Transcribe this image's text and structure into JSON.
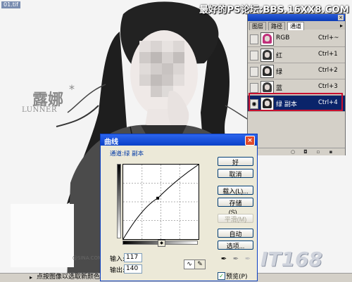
{
  "document": {
    "tab_label": "01.tif"
  },
  "watermarks": {
    "top_right": "最好的PS论坛:BBS.16XX8.COM",
    "bottom_right": "IT168",
    "sina": "@SINA.COM"
  },
  "photo_titles": {
    "chinese": "露娜",
    "english": "LUNNER",
    "star": "*"
  },
  "channels_panel": {
    "tabs": [
      "图层",
      "路径",
      "通道"
    ],
    "active_tab": 2,
    "close_glyph": "×",
    "menu_glyph": "▸",
    "channels": [
      {
        "name": "RGB",
        "shortcut": "Ctrl+~",
        "visible": false,
        "selected": false,
        "thumb_tint": "#c02f7a"
      },
      {
        "name": "红",
        "shortcut": "Ctrl+1",
        "visible": false,
        "selected": false,
        "thumb_tint": "#333333"
      },
      {
        "name": "绿",
        "shortcut": "Ctrl+2",
        "visible": false,
        "selected": false,
        "thumb_tint": "#2a2a2a"
      },
      {
        "name": "蓝",
        "shortcut": "Ctrl+3",
        "visible": false,
        "selected": false,
        "thumb_tint": "#3a3a3a"
      },
      {
        "name": "绿 副本",
        "shortcut": "Ctrl+4",
        "visible": true,
        "selected": true,
        "thumb_tint": "#222222"
      }
    ],
    "eye_glyph": "◉",
    "footer_icons": [
      "load-selection-icon",
      "save-selection-icon",
      "new-channel-icon",
      "delete-channel-icon"
    ]
  },
  "curves_dialog": {
    "title": "曲线",
    "close_glyph": "×",
    "channel_label": "通道:绿 副本",
    "input_label": "输入:",
    "input_value": "117",
    "output_label": "输出:",
    "output_value": "140",
    "curve_point": {
      "input": 117,
      "output": 140
    },
    "buttons": {
      "ok": "好",
      "cancel": "取消",
      "load": "载入(L)...",
      "save": "存储(S)...",
      "smooth": "平滑(M)",
      "auto": "自动",
      "options": "选项..."
    },
    "tool_curve_glyph": "∿",
    "tool_pencil_glyph": "✎",
    "eyedroppers": [
      "black-point-eyedropper-icon",
      "gray-point-eyedropper-icon",
      "white-point-eyedropper-icon"
    ],
    "preview_label": "预览(P)",
    "preview_checked": true,
    "preview_check_glyph": "✓",
    "slider_glyph": "◆"
  },
  "status_bar": {
    "arrow": "▸",
    "text": "点按图像以选取新颜色"
  },
  "colors": {
    "titlebar_blue": "#0a40c8",
    "selected_row": "#0a246a",
    "highlight_red": "#c8102e",
    "dialog_bg": "#ece9d8"
  }
}
